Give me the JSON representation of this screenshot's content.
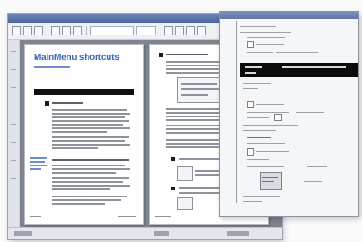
{
  "document": {
    "left_page_title": "MainMenu shortcuts"
  }
}
